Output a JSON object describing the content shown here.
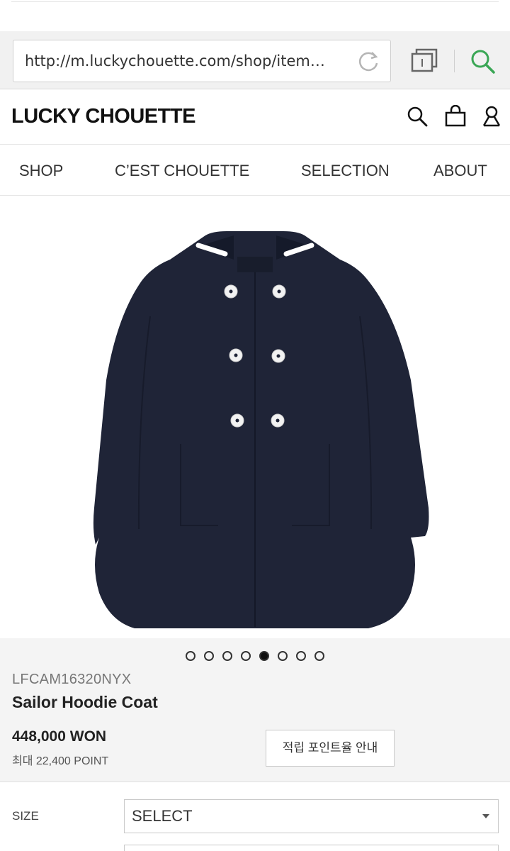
{
  "browser": {
    "url": "http://m.luckychouette.com/shop/item…",
    "reload_icon": "reload-icon",
    "tabs_icon": "tabs-icon",
    "search_icon": "search-icon",
    "accent_color": "#3aa655"
  },
  "header": {
    "logo": "LUCKY CHOUETTE",
    "icons": [
      "search-icon",
      "shopping-bag-icon",
      "user-icon"
    ]
  },
  "nav": {
    "items": [
      {
        "label": "SHOP"
      },
      {
        "label": "C’EST CHOUETTE"
      },
      {
        "label": "SELECTION"
      },
      {
        "label": "ABOUT"
      }
    ]
  },
  "carousel": {
    "total": 8,
    "active_index": 4
  },
  "product": {
    "sku": "LFCAM16320NYX",
    "name": "Sailor Hoodie Coat",
    "price": "448,000 WON",
    "points": "최대 22,400 POINT",
    "points_button": "적립 포인트율 안내",
    "coat_color": "#1f2437"
  },
  "options": {
    "size_label": "SIZE",
    "size_value": "SELECT"
  }
}
